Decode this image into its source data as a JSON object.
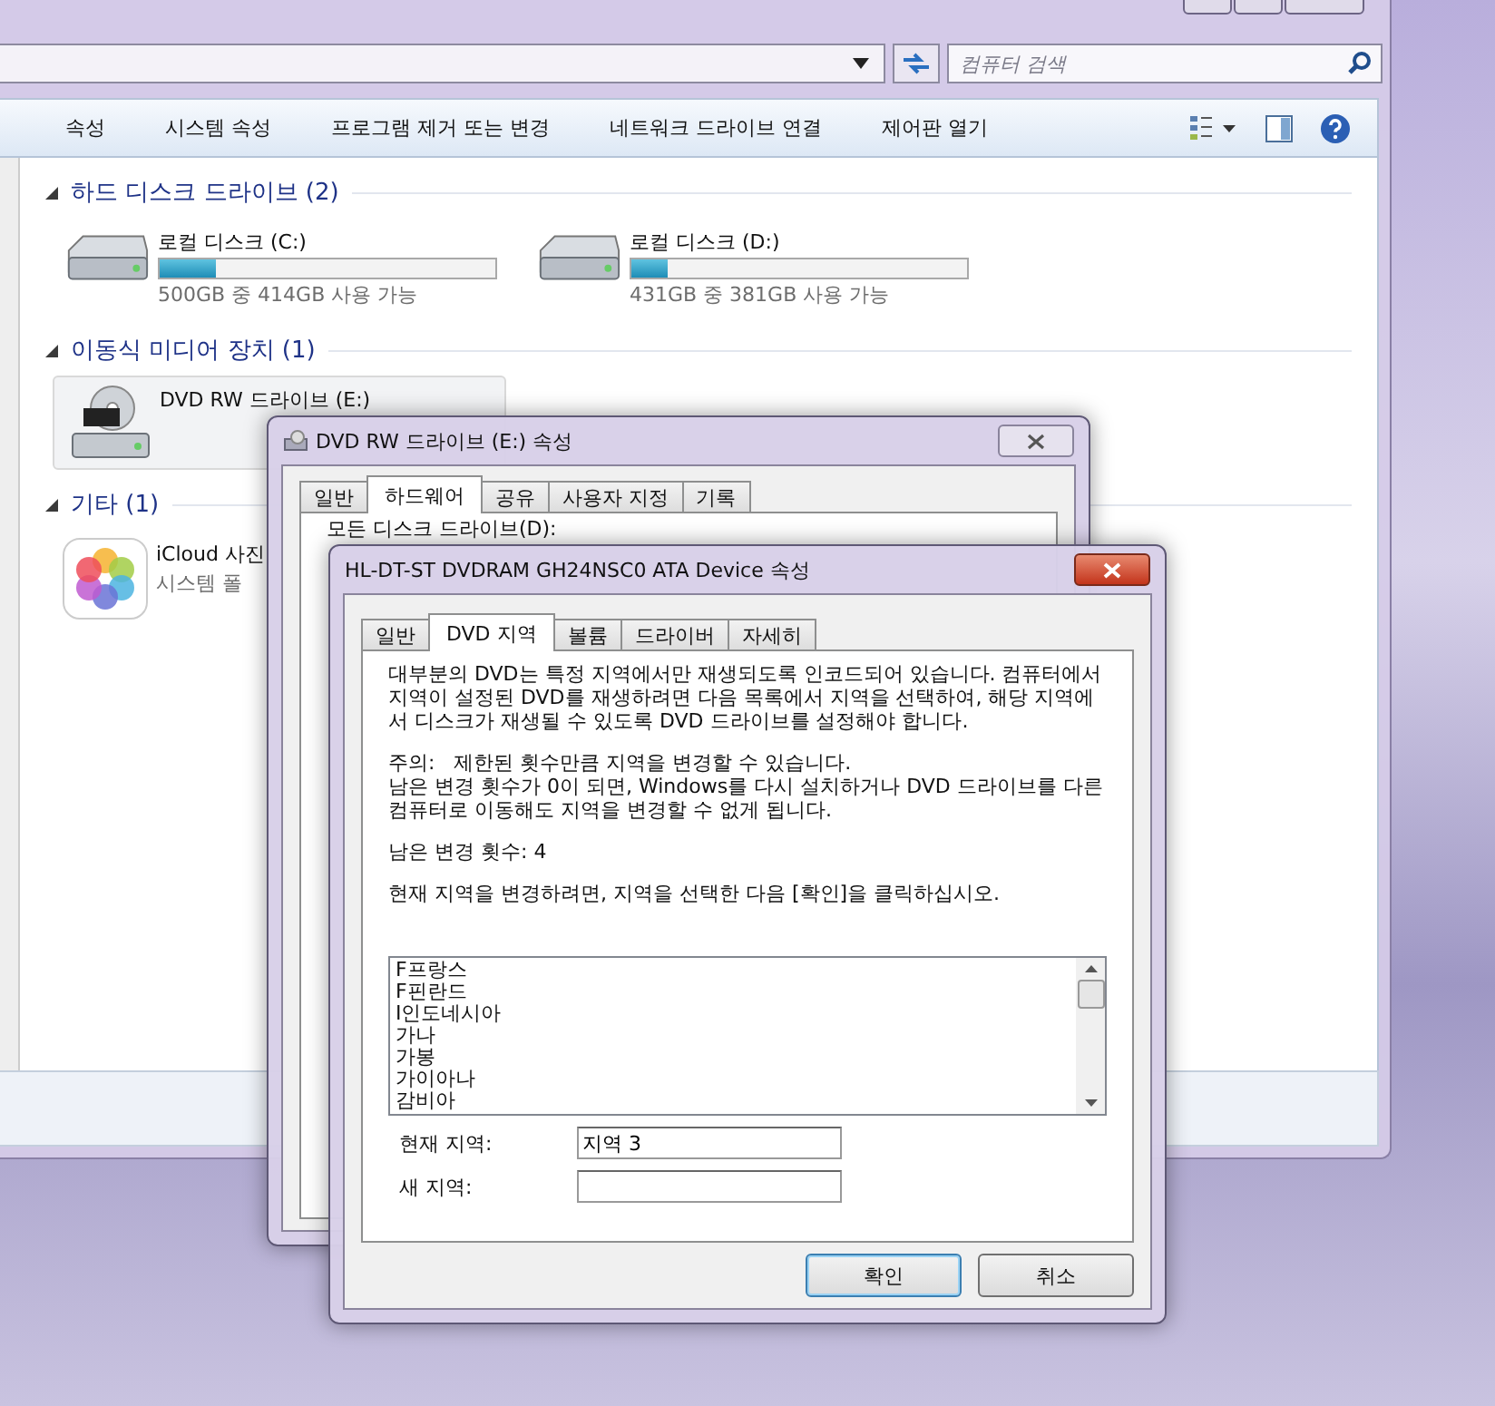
{
  "explorer": {
    "search": {
      "placeholder": "컴퓨터 검색"
    },
    "toolbar": [
      "속성",
      "시스템 속성",
      "프로그램 제거 또는 변경",
      "네트워크 드라이브 연결",
      "제어판 열기"
    ],
    "groups": [
      {
        "title": "하드 디스크 드라이브 (2)",
        "expanded": true,
        "items": [
          {
            "kind": "disk",
            "name": "로컬 디스크 (C:)",
            "level": 0.17,
            "space": "500GB 중 414GB 사용 가능",
            "selected": false
          },
          {
            "kind": "disk",
            "name": "로컬 디스크 (D:)",
            "level": 0.11,
            "space": "431GB 중 381GB 사용 가능",
            "selected": false
          }
        ]
      },
      {
        "title": "이동식 미디어 장치 (1)",
        "expanded": true,
        "items": [
          {
            "kind": "optical",
            "name": "DVD RW 드라이브 (E:)",
            "selected": true
          }
        ]
      },
      {
        "title": "기타 (1)",
        "expanded": true,
        "items": [
          {
            "kind": "folder",
            "name": "iCloud 사진",
            "subtitle": "시스템 폴",
            "selected": false
          }
        ]
      }
    ]
  },
  "drive_dialog": {
    "title": "DVD RW 드라이브 (E:) 속성",
    "tabs": [
      {
        "label": "일반",
        "selected": false
      },
      {
        "label": "하드웨어",
        "selected": true
      },
      {
        "label": "공유",
        "selected": false
      },
      {
        "label": "사용자 지정",
        "selected": false
      },
      {
        "label": "기록",
        "selected": false
      }
    ],
    "label": "모든 디스크 드라이브(D):"
  },
  "device_dialog": {
    "title": "HL-DT-ST DVDRAM GH24NSC0 ATA Device 속성",
    "tabs": [
      {
        "label": "일반",
        "selected": false
      },
      {
        "label": "DVD 지역",
        "selected": true
      },
      {
        "label": "볼륨",
        "selected": false
      },
      {
        "label": "드라이버",
        "selected": false
      },
      {
        "label": "자세히",
        "selected": false
      }
    ],
    "paragraphs": [
      {
        "lines": [
          "대부분의 DVD는 특정 지역에서만 재생되도록 인코드되어 있습니다. 컴퓨터에서 지역이 설정된 DVD를 재생하려면 다음 목록에서 지역을 선택하여, 해당 지역에서 디스크가 재생될 수 있도록 DVD 드라이브를 설정해야 합니다."
        ]
      },
      {
        "lines": [
          "주의:   제한된 횟수만큼 지역을 변경할 수 있습니다.",
          "남은 변경 횟수가 0이 되면, Windows를 다시 설치하거나 DVD 드라이브를 다른 컴퓨터로 이동해도 지역을 변경할 수 없게 됩니다."
        ]
      },
      {
        "lines": [
          "남은 변경 횟수: 4"
        ]
      },
      {
        "lines": [
          "현재 지역을 변경하려면, 지역을 선택한 다음 [확인]을 클릭하십시오."
        ]
      }
    ],
    "regions": [
      "F프랑스",
      "F핀란드",
      "I인도네시아",
      "가나",
      "가봉",
      "가이아나",
      "감비아"
    ],
    "fields": [
      {
        "label": "현재 지역:",
        "value": "지역 3"
      },
      {
        "label": "새 지역:"
      }
    ],
    "buttons": [
      {
        "label": "확인",
        "default": true
      },
      {
        "label": "취소",
        "default": false
      }
    ]
  }
}
